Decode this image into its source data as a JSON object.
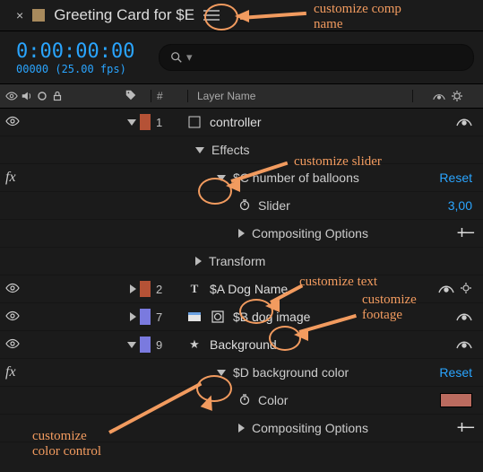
{
  "tab": {
    "close_glyph": "×",
    "comp_name": "Greeting Card for $E"
  },
  "timecode": {
    "main": "0:00:00:00",
    "sub": "00000 (25.00 fps)"
  },
  "search": {
    "placeholder": ""
  },
  "columns": {
    "index_header": "#",
    "name_header": "Layer Name"
  },
  "layers": [
    {
      "index": "1",
      "name": "controller",
      "color": "#b55236",
      "twirl": "down",
      "toggles": {
        "shy": true
      }
    },
    {
      "index": "2",
      "name": "$A Dog Name",
      "color": "#b55236",
      "twirl": "right",
      "type": "text",
      "toggles": {
        "shy": true,
        "mb": true
      }
    },
    {
      "index": "7",
      "name": "$B dog image",
      "color": "#7a7adf",
      "twirl": "right",
      "type": "footage",
      "toggles": {
        "shy": true
      }
    },
    {
      "index": "9",
      "name": "Background",
      "color": "#7a7adf",
      "twirl": "down",
      "type": "solid",
      "toggles": {
        "shy": true
      }
    }
  ],
  "groups": {
    "effects": "Effects",
    "transform": "Transform",
    "comp_options": "Compositing Options"
  },
  "props": {
    "slider_effect": {
      "name": "$C number of balloons",
      "reset": "Reset"
    },
    "slider_param": {
      "name": "Slider",
      "value": "3,00"
    },
    "color_effect": {
      "name": "$D background color",
      "reset": "Reset"
    },
    "color_param": {
      "name": "Color",
      "value": "#bb6b5f"
    }
  },
  "buttons": {
    "plus_minus": "+−"
  },
  "annotations": {
    "comp": "customize comp\nname",
    "slider": "customize slider",
    "text": "customize text",
    "footage": "customize\nfootage",
    "color": "customize\ncolor control"
  }
}
